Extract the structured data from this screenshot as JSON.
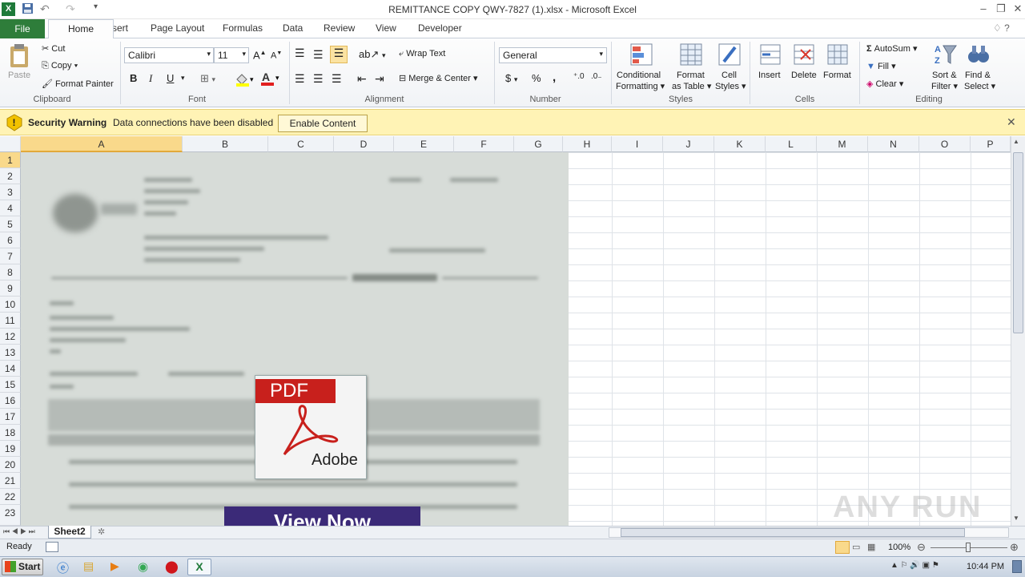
{
  "window": {
    "title": "REMITTANCE COPY QWY-7827 (1).xlsx - Microsoft Excel"
  },
  "tabs": [
    "File",
    "Home",
    "Insert",
    "Page Layout",
    "Formulas",
    "Data",
    "Review",
    "View",
    "Developer"
  ],
  "ribbon": {
    "clipboard": {
      "paste": "Paste",
      "cut": "Cut",
      "copy": "Copy",
      "format_painter": "Format Painter",
      "label": "Clipboard"
    },
    "font": {
      "name": "Calibri",
      "size": "11",
      "bold": "B",
      "italic": "I",
      "underline": "U",
      "label": "Font"
    },
    "alignment": {
      "wrap": "Wrap Text",
      "merge": "Merge & Center",
      "label": "Alignment"
    },
    "number": {
      "format": "General",
      "currency": "$",
      "percent": "%",
      "comma": ",",
      "label": "Number"
    },
    "styles": {
      "cond_1": "Conditional",
      "cond_2": "Formatting",
      "fmt_1": "Format",
      "fmt_2": "as Table",
      "cell_1": "Cell",
      "cell_2": "Styles",
      "label": "Styles"
    },
    "cells": {
      "insert": "Insert",
      "delete": "Delete",
      "format": "Format",
      "label": "Cells"
    },
    "editing": {
      "autosum": "AutoSum",
      "fill": "Fill",
      "clear": "Clear",
      "sort_1": "Sort &",
      "sort_2": "Filter",
      "find_1": "Find &",
      "find_2": "Select",
      "label": "Editing"
    }
  },
  "security": {
    "title": "Security Warning",
    "message": "Data connections have been disabled",
    "button": "Enable Content"
  },
  "columns": [
    "A",
    "B",
    "C",
    "D",
    "E",
    "F",
    "G",
    "H",
    "I",
    "J",
    "K",
    "L",
    "M",
    "N",
    "O",
    "P"
  ],
  "rows": [
    "1",
    "2",
    "3",
    "4",
    "5",
    "6",
    "7",
    "8",
    "9",
    "10",
    "11",
    "12",
    "13",
    "14",
    "15",
    "16",
    "17",
    "18",
    "19",
    "20",
    "21",
    "22",
    "23"
  ],
  "image": {
    "pdf_label": "PDF",
    "brand": "Adobe",
    "button": "View Now"
  },
  "sheet_tab": "Sheet2",
  "status": {
    "ready": "Ready",
    "zoom": "100%"
  },
  "watermark": "ANY RUN",
  "taskbar": {
    "start": "Start",
    "time": "10:44 PM"
  },
  "colors": {
    "file_tab": "#2e7d3a",
    "security_bg": "#fff3b5",
    "selected_header": "#f9d98b",
    "pdf_red": "#c8201c",
    "view_now": "#3b2a78"
  }
}
